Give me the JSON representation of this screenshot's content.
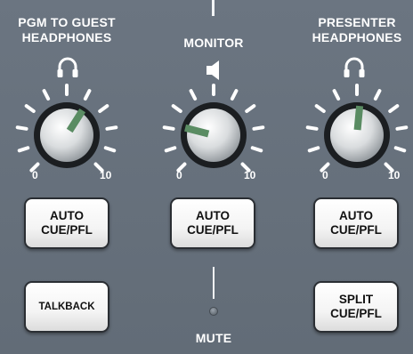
{
  "sections": {
    "pgm_guest": {
      "title": "PGM TO GUEST\nHEADPHONES",
      "scale_min": "0",
      "scale_max": "10",
      "button_label": "AUTO\nCUE/PFL",
      "button2_label": "TALKBACK",
      "knob_level": 0.62
    },
    "monitor": {
      "title": "MONITOR",
      "scale_min": "0",
      "scale_max": "10",
      "button_label": "AUTO\nCUE/PFL",
      "mute_label": "MUTE",
      "knob_level": 0.22
    },
    "presenter": {
      "title": "PRESENTER\nHEADPHONES",
      "scale_min": "0",
      "scale_max": "10",
      "button_label": "AUTO\nCUE/PFL",
      "button2_label": "SPLIT\nCUE/PFL",
      "knob_level": 0.52
    }
  },
  "icons": {
    "headphones": "headphones-icon",
    "speaker": "speaker-icon"
  },
  "colors": {
    "panel": "#66707b",
    "indicator": "#5a8c63",
    "button": "#f4f4f4",
    "text": "#ffffff"
  }
}
